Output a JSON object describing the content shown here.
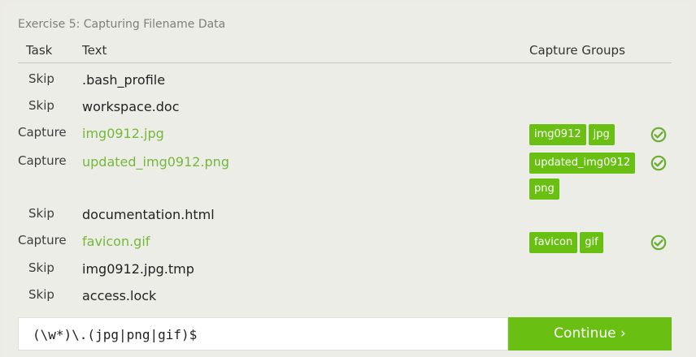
{
  "exercise": {
    "title": "Exercise 5: Capturing Filename Data"
  },
  "table": {
    "headers": {
      "task": "Task",
      "text": "Text",
      "groups": "Capture Groups"
    },
    "rows": [
      {
        "task": "Skip",
        "text": ".bash_profile",
        "groups": [],
        "status": ""
      },
      {
        "task": "Skip",
        "text": "workspace.doc",
        "groups": [],
        "status": ""
      },
      {
        "task": "Capture",
        "text": "img0912.jpg",
        "groups": [
          "img0912",
          "jpg"
        ],
        "status": "check-circle-icon"
      },
      {
        "task": "Capture",
        "text": "updated_img0912.png",
        "groups": [
          "updated_img0912",
          "png"
        ],
        "status": "check-circle-icon"
      },
      {
        "task": "Skip",
        "text": "documentation.html",
        "groups": [],
        "status": ""
      },
      {
        "task": "Capture",
        "text": "favicon.gif",
        "groups": [
          "favicon",
          "gif"
        ],
        "status": "check-circle-icon"
      },
      {
        "task": "Skip",
        "text": "img0912.jpg.tmp",
        "groups": [],
        "status": ""
      },
      {
        "task": "Skip",
        "text": "access.lock",
        "groups": [],
        "status": ""
      }
    ]
  },
  "regex": {
    "value": "(\\w*)\\.(jpg|png|gif)$"
  },
  "actions": {
    "continue_label": "Continue ›"
  },
  "colors": {
    "accent": "#69c012",
    "capture_text": "#74b83a",
    "check": "#6cae34"
  }
}
